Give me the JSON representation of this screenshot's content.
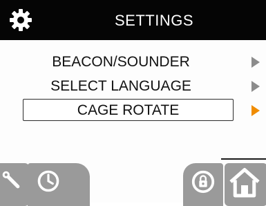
{
  "header": {
    "title": "SETTINGS",
    "icon": "gear-icon"
  },
  "menu": {
    "items": [
      {
        "label": "BEACON/SOUNDER",
        "selected": false
      },
      {
        "label": "SELECT LANGUAGE",
        "selected": false
      },
      {
        "label": "CAGE ROTATE",
        "selected": true
      }
    ]
  },
  "bottom_bar": {
    "buttons": [
      {
        "icon": "wrench-icon"
      },
      {
        "icon": "clock-icon"
      },
      {
        "icon": "lock-rotate-icon"
      },
      {
        "icon": "home-icon"
      }
    ]
  },
  "colors": {
    "header_bg": "#050505",
    "header_text": "#ffffff",
    "arrow_default": "#8c8c8c",
    "arrow_selected": "#f08c00",
    "button_bg": "#9a9a9a"
  }
}
